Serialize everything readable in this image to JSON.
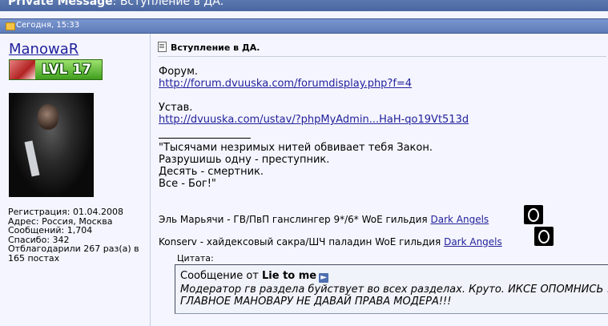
{
  "header": {
    "title_bold": "Private Message",
    "title_rest": ": Вступление в ДА."
  },
  "post": {
    "date": "Сегодня, 15:33",
    "user": {
      "name": "ManowaR",
      "level_badge": "LVL 17",
      "stats": {
        "registration": "Регистрация: 01.04.2008",
        "address": "Адрес: Россия, Москва",
        "messages": "Сообщений: 1,704",
        "thanks": "Спасибо: 342",
        "thanked": "Отблагодарили 267 раз(а) в 165 постах"
      }
    },
    "title": "Вступление в ДА.",
    "body": {
      "forum_label": "Форум.",
      "forum_link": "http://forum.dvuuska.com/forumdisplay.php?f=4",
      "rules_label": "Устав.",
      "rules_link": "http://dvuuska.com/ustav/?phpMyAdmin...HaH-qo19Vt513d",
      "quote_lines": [
        "\"Тысячами незримых нитей обвивает тебя Закон.",
        "Разрушишь одну - преступник.",
        "Десять - смертник.",
        "Все - Бог!\""
      ]
    },
    "signature": [
      {
        "text": "Эль Марьячи - ГВ/ПвП ганслингер 9*/6* WoE гильдия ",
        "guild": "Dark Angels"
      },
      {
        "text": "Konserv - хайдексовый сакра/ШЧ паладин WoE гильдия ",
        "guild": "Dark Angels"
      }
    ],
    "quote": {
      "label": "Цитата:",
      "header_prefix": "Сообщение от ",
      "author": "Lie to me",
      "lines": [
        "Модератор гв раздела буйствует во всех разделах. Круто. ИКСЕ ОПОМНИСЬ !",
        "ГЛАВНОЕ МАНОВАРУ НЕ ДАВАЙ ПРАВА МОДЕРА!!!"
      ]
    }
  },
  "icons": {
    "folder": "folder-icon",
    "document": "document-icon",
    "view_post": "arrow-right-icon",
    "guild_emblem": "guild-emblem-icon"
  }
}
